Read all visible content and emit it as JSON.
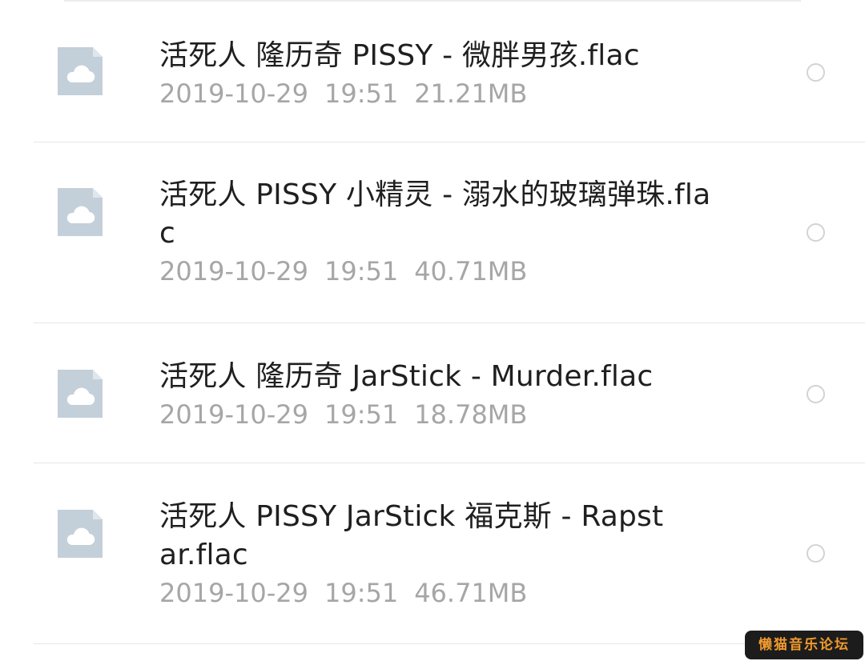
{
  "files": [
    {
      "name": "活死人 隆历奇 PISSY - 微胖男孩.flac",
      "date": "2019-10-29",
      "time": "19:51",
      "size": "21.21MB",
      "icon": "cloud-file-icon",
      "selected": false
    },
    {
      "name": "活死人 PISSY 小精灵 - 溺水的玻璃弹珠.flac",
      "date": "2019-10-29",
      "time": "19:51",
      "size": "40.71MB",
      "icon": "cloud-file-icon",
      "selected": false
    },
    {
      "name": "活死人 隆历奇 JarStick - Murder.flac",
      "date": "2019-10-29",
      "time": "19:51",
      "size": "18.78MB",
      "icon": "cloud-file-icon",
      "selected": false
    },
    {
      "name": "活死人 PISSY JarStick 福克斯 - Rapstar.flac",
      "date": "2019-10-29",
      "time": "19:51",
      "size": "46.71MB",
      "icon": "cloud-file-icon",
      "selected": false
    }
  ],
  "watermark": {
    "text": "懒猫音乐论坛"
  },
  "colors": {
    "icon_fill": "#c3cfd9",
    "filename_text": "#1f1f1f",
    "meta_text": "#a6a6a6",
    "divider": "#e6e6e6",
    "radio_border": "#d3d3d3",
    "watermark_bg": "#1c1c1c",
    "watermark_text": "#f19a2d"
  }
}
